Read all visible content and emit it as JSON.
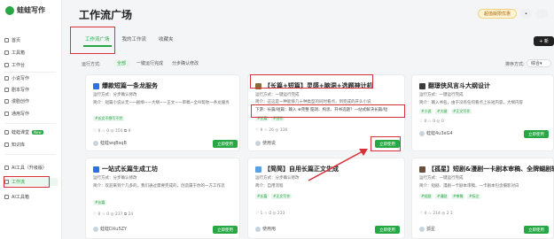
{
  "app": {
    "name": "蛙蛙写作"
  },
  "sidebar": {
    "items": [
      {
        "label": "首页"
      },
      {
        "label": "工具箱"
      },
      {
        "label": "工作台"
      },
      {
        "label": "小说写作"
      },
      {
        "label": "剧本写作"
      },
      {
        "label": "漫剧创作"
      },
      {
        "label": "通用写作"
      },
      {
        "label": "蛙蛙课堂"
      },
      {
        "label": "知识库"
      },
      {
        "label": "AI工具（升级版）"
      },
      {
        "label": "工作流"
      },
      {
        "label": "AI工具箱"
      }
    ],
    "new_badge": "New"
  },
  "header": {
    "title": "工作流广场",
    "vip_button": "超值版限优惠",
    "create_button": "+ 新"
  },
  "tabs": [
    {
      "label": "工作流广场"
    },
    {
      "label": "我的工作流"
    },
    {
      "label": "收藏夹"
    }
  ],
  "filters": {
    "mode_label": "运行方式:",
    "options": [
      "全部",
      "一键运行完成",
      "分步确认修改"
    ],
    "sort_label": "排序方式:",
    "sort_value": "综合"
  },
  "cards": [
    {
      "title": "爆款短篇一条龙服务",
      "mode": "运行方式：分步确认修改",
      "intro": "简介：短篇小说从无~一剧纲~一大纲~一正文~一审稿~全AI帮你一条龙服务",
      "tags": [
        "#长文不想写不完"
      ],
      "stats": "♡ 0  ☆ 0  ◎ 150  ⧉ 9",
      "author": "蛙蛙wqBsqB",
      "button": "立即使用"
    },
    {
      "title": "【长篇+短篇】灵感+脑洞+选题神计机",
      "mode": "运行方式：一键运行完成",
      "intro": "简介：这这是一种能够几十种类型的同时看点，到完成的开头小说",
      "inputs": "下游：长篇/短篇：输入 ⊕完整  脑洞、构思、开书选题？一站式解决长篇/短",
      "tags": [
        "#长篇",
        "#创作"
      ],
      "stats": "♡ 9  ☆ 26  ◎ 336",
      "author": "使用说",
      "button": "立即使用"
    },
    {
      "title": "翻璟侠风言斗大纲设计",
      "mode": "运行方式：一键运行完成",
      "intro": "简介：输入书名，由于没有任何看点上长短内容，大纲内容",
      "tags": [
        "#小说",
        "#大纲",
        "#正文写作"
      ],
      "stats": "♡ 0  ☆ 0  ◎ 0",
      "author": "蛙蛙4u3eG4",
      "button": "立即使用"
    },
    {
      "title": "一站式长篇生成工坊",
      "mode": "运行方式：分步确认修改",
      "intro": "简介：欢迎来到个几多的，我们通过需要完成的，创造属于你的一方工作流",
      "tags": [
        "#长篇"
      ],
      "stats": "♡ 0  ☆ 0  ◎ 237  ⧉ 24",
      "author": "蛙蛙DXu5ZY",
      "button": "立即使用"
    },
    {
      "title": "【简简】自用长篇正文生成",
      "mode": "运行方式：分步确认修改",
      "intro": "简介：自用流程",
      "tags": [
        "#长篇",
        "#正文写作"
      ],
      "stats": "♡ 1  ☆ 0  ◎ 233",
      "author": "使用用",
      "button": "立即使用"
    },
    {
      "title": "【孤星】短剧&漫剧一卡剧本审稿、全牌蝴剧转市",
      "mode": "运行方式：一键运行完成",
      "intro": "简介：短剧、漫剧一卡剧本审稿，一卡剧本包含摄影对白",
      "tags": [
        "#短剧",
        "#漫剧",
        "#审稿",
        "#标注"
      ],
      "stats": "♡ 4  ☆ 214  ◎ 2 3",
      "author": "孤星",
      "button": "立即使用"
    }
  ],
  "colors": {
    "accent": "#27a844",
    "highlight": "#d9303a",
    "title_icon": "#2f6fe0"
  }
}
